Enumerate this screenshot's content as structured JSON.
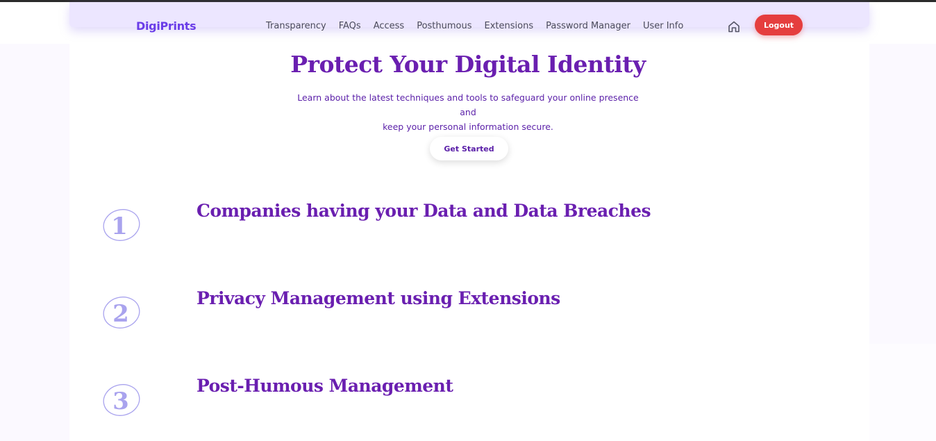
{
  "header": {
    "brand": "DigiPrints",
    "nav": [
      "Transparency",
      "FAQs",
      "Access",
      "Posthumous",
      "Extensions",
      "Password Manager",
      "User Info"
    ],
    "logout_label": "Logout",
    "home_icon": "home-icon"
  },
  "hero": {
    "title": "Protect Your Digital Identity",
    "subtitle_line1": "Learn about the latest techniques and tools to safeguard your online presence and",
    "subtitle_line2": "keep your personal information secure.",
    "cta_label": "Get Started"
  },
  "steps": [
    {
      "number": "1",
      "title": "Companies having your Data and Data Breaches"
    },
    {
      "number": "2",
      "title": "Privacy Management using Extensions"
    },
    {
      "number": "3",
      "title": "Post-Humous Management"
    }
  ],
  "colors": {
    "brand": "#6a3de8",
    "heading": "#6a1fb0",
    "logout": "#e53e3e",
    "step_number": "#a9a3ee"
  }
}
